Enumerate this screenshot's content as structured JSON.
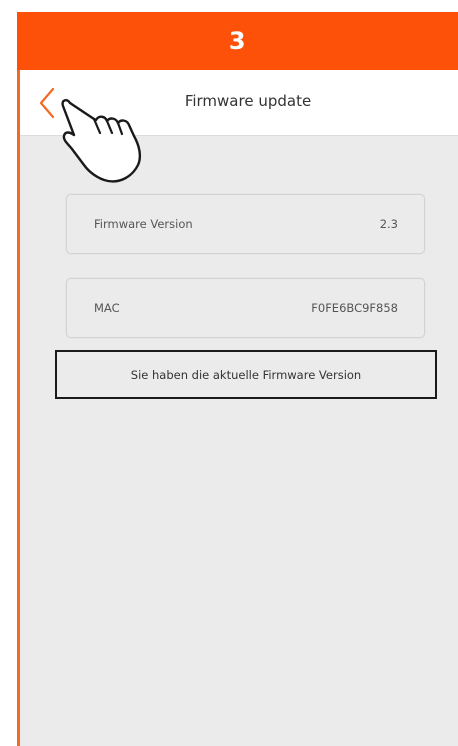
{
  "step": {
    "number": "3",
    "color": "#fd5008"
  },
  "header": {
    "title": "Firmware update",
    "back_icon": "chevron-left-icon",
    "accent_color": "#f36b22"
  },
  "info": {
    "firmware": {
      "label": "Firmware Version",
      "value": "2.3"
    },
    "mac": {
      "label": "MAC",
      "value": "F0FE6BC9F858"
    }
  },
  "status": {
    "message": "Sie haben die aktuelle Firmware Version"
  },
  "overlay": {
    "icon": "hand-pointer-icon"
  }
}
